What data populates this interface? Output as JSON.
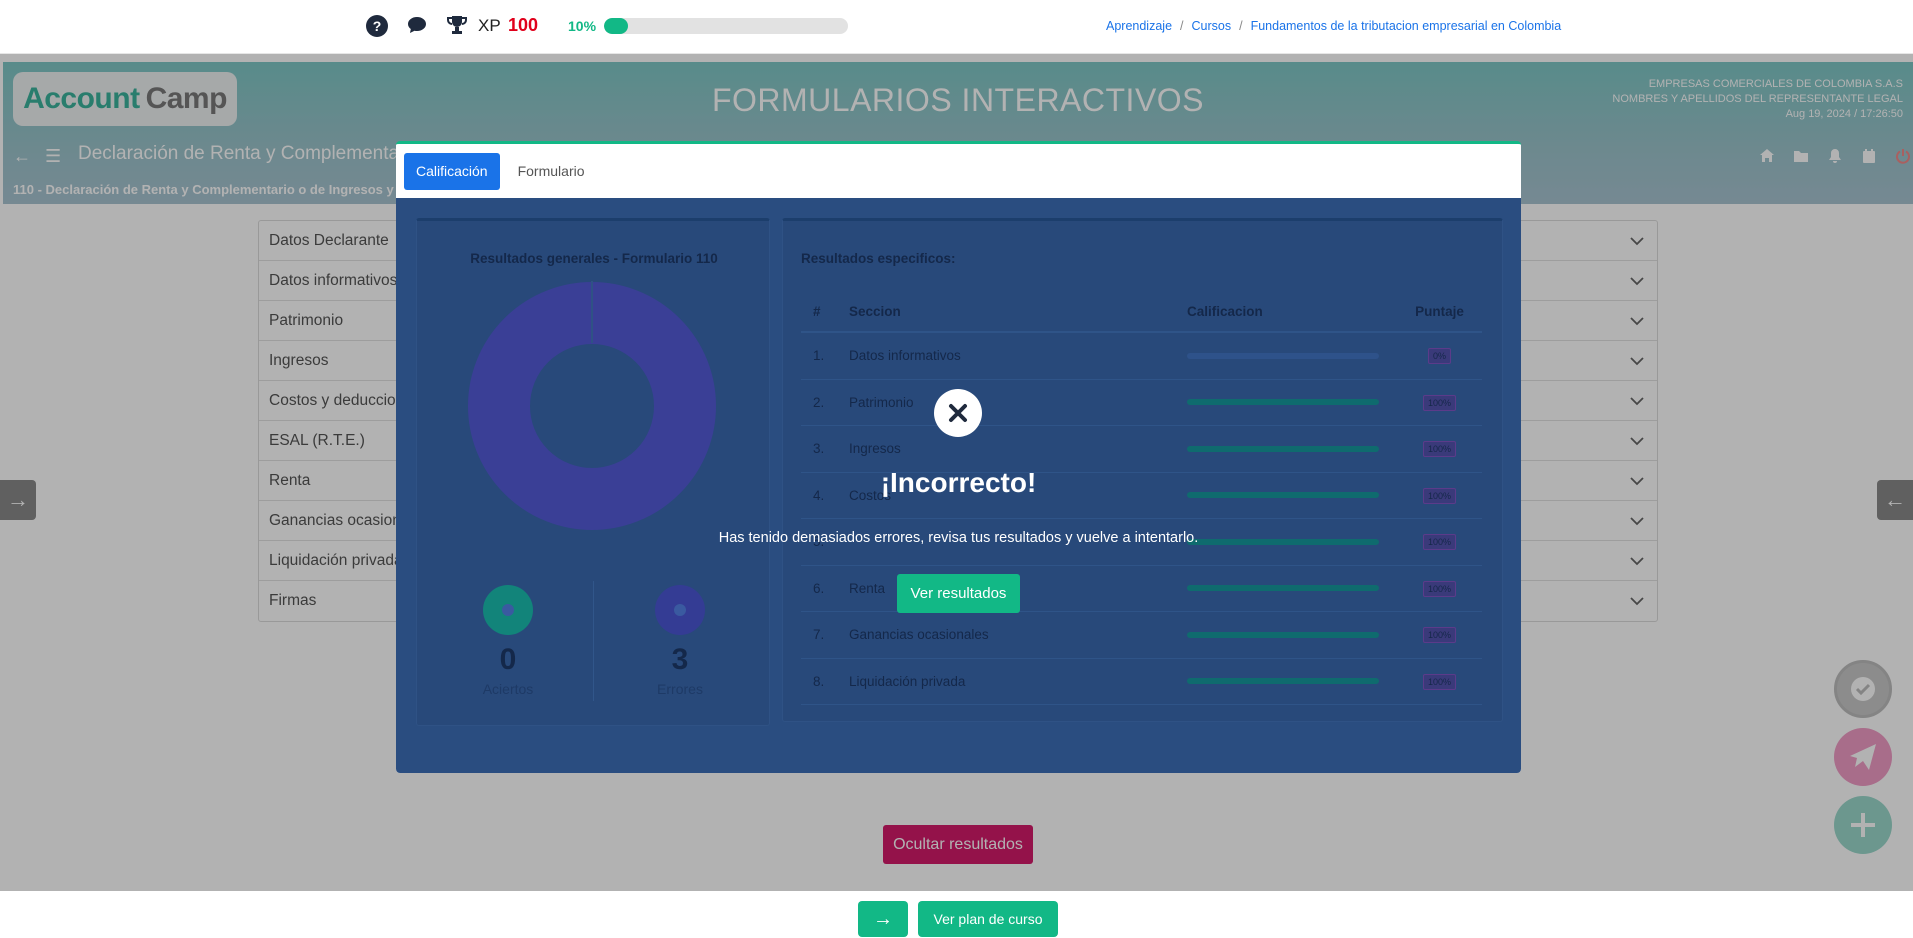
{
  "topbar": {
    "icons": [
      "help-icon",
      "chat-icon",
      "trophy-icon"
    ],
    "xp_label": "XP",
    "xp_value": "100",
    "progress_text": "10%",
    "progress_value": 0.1,
    "breadcrumb": [
      "Aprendizaje",
      "Cursos",
      "Fundamentos de la tributacion empresarial en Colombia"
    ]
  },
  "header": {
    "logo_part1": "Account",
    "logo_part2": "Camp",
    "title": "FORMULARIOS INTERACTIVOS",
    "company_name": "EMPRESAS COMERCIALES DE COLOMBIA S.A.S",
    "representative": "NOMBRES Y APELLIDOS DEL REPRESENTANTE LEGAL",
    "datetime": "Aug 19, 2024 / 17:26:50",
    "doc_title": "Declaración de Renta y Complementario",
    "doc_subtitle": "110 - Declaración de Renta y Complementario o de Ingresos y",
    "icons": [
      "home-icon",
      "folder-icon",
      "bell-icon",
      "calendar-icon",
      "power-icon"
    ]
  },
  "accordion": {
    "items": [
      "Datos Declarante",
      "Datos informativos",
      "Patrimonio",
      "Ingresos",
      "Costos y deducciones",
      "ESAL (R.T.E.)",
      "Renta",
      "Ganancias ocasionales",
      "Liquidación privada",
      "Firmas"
    ]
  },
  "modal": {
    "tabs": [
      "Calificación",
      "Formulario"
    ],
    "left_title": "Resultados generales - Formulario 110",
    "aciertos_value": "0",
    "aciertos_label": "Aciertos",
    "errores_value": "3",
    "errores_label": "Errores",
    "right_title": "Resultados especificos:",
    "table_headers": [
      "#",
      "Seccion",
      "Calificacion",
      "Puntaje"
    ],
    "rows": [
      {
        "num": "1.",
        "section": "Datos informativos",
        "score": "0%",
        "fill": 0
      },
      {
        "num": "2.",
        "section": "Patrimonio",
        "score": "100%",
        "fill": 1
      },
      {
        "num": "3.",
        "section": "Ingresos",
        "score": "100%",
        "fill": 1
      },
      {
        "num": "4.",
        "section": "Costos",
        "score": "100%",
        "fill": 1
      },
      {
        "num": "5.",
        "section": "",
        "score": "100%",
        "fill": 1
      },
      {
        "num": "6.",
        "section": "Renta",
        "score": "100%",
        "fill": 1
      },
      {
        "num": "7.",
        "section": "Ganancias ocasionales",
        "score": "100%",
        "fill": 1
      },
      {
        "num": "8.",
        "section": "Liquidación privada",
        "score": "100%",
        "fill": 1
      }
    ]
  },
  "alert": {
    "icon": "close-icon",
    "title": "¡Incorrecto!",
    "message": "Has tenido demasiados errores, revisa tus resultados y vuelve a intentarlo.",
    "button": "Ver resultados"
  },
  "actions": {
    "hide_results": "Ocultar resultados",
    "view_plan": "Ver plan de curso"
  },
  "colors": {
    "accent_green": "#12b886",
    "primary_blue": "#1a73e8",
    "pink": "#d41b6a",
    "xp_red": "#e0001b"
  }
}
